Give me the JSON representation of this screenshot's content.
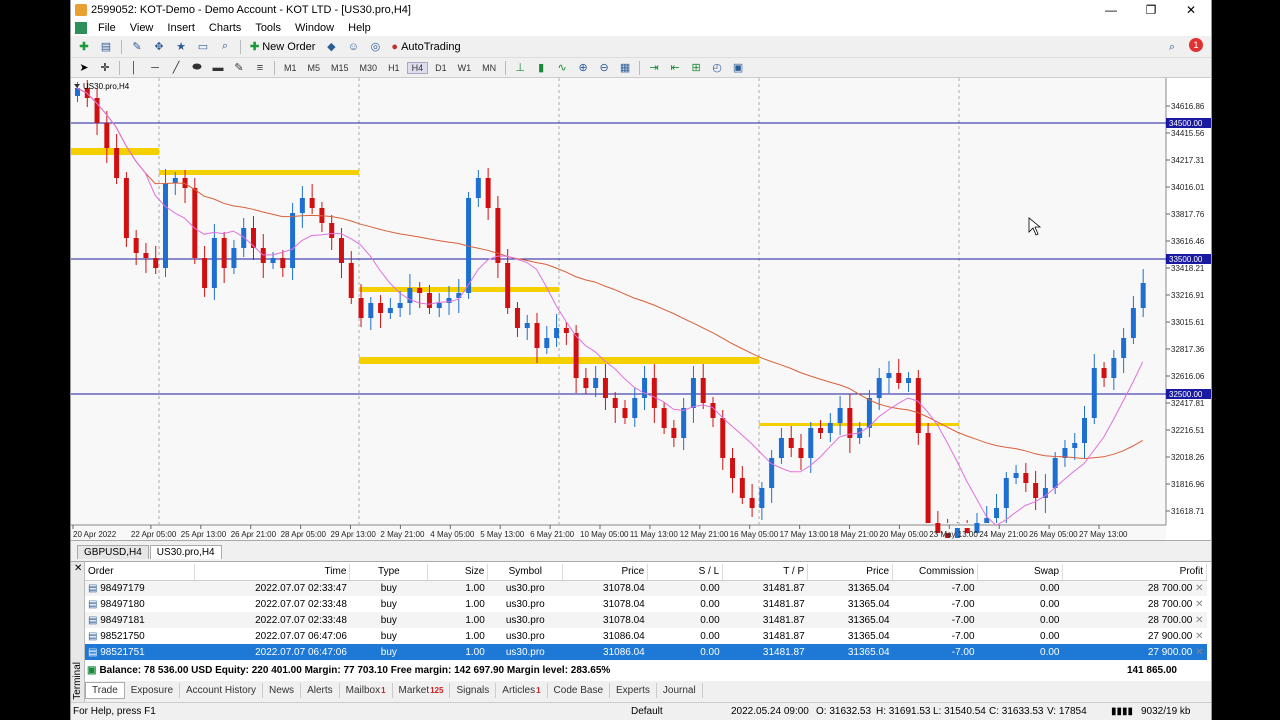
{
  "window": {
    "title": "2599052: KOT-Demo - Demo Account - KOT LTD - [US30.pro,H4]",
    "min": "—",
    "max": "❐",
    "close": "✕"
  },
  "menu": [
    "File",
    "View",
    "Insert",
    "Charts",
    "Tools",
    "Window",
    "Help"
  ],
  "toolbar": {
    "new_order": "New Order",
    "autotrading": "AutoTrading",
    "timeframes": [
      "M1",
      "M5",
      "M15",
      "M30",
      "H1",
      "H4",
      "D1",
      "W1",
      "MN"
    ],
    "active_timeframe": "H4"
  },
  "chart": {
    "symbol_label": "US30.pro,H4",
    "price_labels": [
      "34616.86",
      "34415.56",
      "34217.31",
      "34016.01",
      "33817.76",
      "33616.46",
      "33418.21",
      "33216.91",
      "33015.61",
      "32817.36",
      "32616.06",
      "32417.81",
      "32216.51",
      "32018.26",
      "31816.96",
      "31618.71"
    ],
    "level_labels": [
      "34500.00",
      "33500.00",
      "32500.00"
    ],
    "time_labels": [
      "20 Apr 2022",
      "22 Apr 05:00",
      "25 Apr 13:00",
      "26 Apr 21:00",
      "28 Apr 05:00",
      "29 Apr 13:00",
      "2 May 21:00",
      "4 May 05:00",
      "5 May 13:00",
      "6 May 21:00",
      "10 May 05:00",
      "11 May 13:00",
      "12 May 21:00",
      "16 May 05:00",
      "17 May 13:00",
      "18 May 21:00",
      "20 May 05:00",
      "23 May 13:00",
      "24 May 21:00",
      "26 May 05:00",
      "27 May 13:00"
    ],
    "colors": {
      "bull": "#1e6fd0",
      "bear": "#d01010",
      "level": "#1a1aa0",
      "zone": "#f5d000",
      "ma_slow": "#d9603a",
      "ma_fast": "#e070e0"
    }
  },
  "chart_tabs": [
    "GBPUSD,H4",
    "US30.pro,H4"
  ],
  "active_chart_tab": "US30.pro,H4",
  "terminal": {
    "label": "Terminal",
    "columns": [
      "Order",
      "Time",
      "Type",
      "Size",
      "Symbol",
      "Price",
      "S / L",
      "T / P",
      "Price",
      "Commission",
      "Swap",
      "Profit"
    ],
    "rows": [
      [
        "98497179",
        "2022.07.07 02:33:47",
        "buy",
        "1.00",
        "us30.pro",
        "31078.04",
        "0.00",
        "31481.87",
        "31365.04",
        "-7.00",
        "0.00",
        "28 700.00"
      ],
      [
        "98497180",
        "2022.07.07 02:33:48",
        "buy",
        "1.00",
        "us30.pro",
        "31078.04",
        "0.00",
        "31481.87",
        "31365.04",
        "-7.00",
        "0.00",
        "28 700.00"
      ],
      [
        "98497181",
        "2022.07.07 02:33:48",
        "buy",
        "1.00",
        "us30.pro",
        "31078.04",
        "0.00",
        "31481.87",
        "31365.04",
        "-7.00",
        "0.00",
        "28 700.00"
      ],
      [
        "98521750",
        "2022.07.07 06:47:06",
        "buy",
        "1.00",
        "us30.pro",
        "31086.04",
        "0.00",
        "31481.87",
        "31365.04",
        "-7.00",
        "0.00",
        "27 900.00"
      ],
      [
        "98521751",
        "2022.07.07 06:47:06",
        "buy",
        "1.00",
        "us30.pro",
        "31086.04",
        "0.00",
        "31481.87",
        "31365.04",
        "-7.00",
        "0.00",
        "27 900.00"
      ]
    ],
    "summary": "Balance: 78 536.00 USD  Equity: 220 401.00  Margin: 77 703.10  Free margin: 142 697.90  Margin level: 283.65%",
    "total_profit": "141 865.00",
    "tabs": [
      {
        "label": "Trade",
        "badge": ""
      },
      {
        "label": "Exposure",
        "badge": ""
      },
      {
        "label": "Account History",
        "badge": ""
      },
      {
        "label": "News",
        "badge": ""
      },
      {
        "label": "Alerts",
        "badge": ""
      },
      {
        "label": "Mailbox",
        "badge": "1"
      },
      {
        "label": "Market",
        "badge": "125"
      },
      {
        "label": "Signals",
        "badge": ""
      },
      {
        "label": "Articles",
        "badge": "1"
      },
      {
        "label": "Code Base",
        "badge": ""
      },
      {
        "label": "Experts",
        "badge": ""
      },
      {
        "label": "Journal",
        "badge": ""
      }
    ]
  },
  "status": {
    "help": "For Help, press F1",
    "profile": "Default",
    "datetime": "2022.05.24 09:00",
    "open": "O: 31632.53",
    "high": "H: 31691.53",
    "low": "L: 31540.54",
    "close": "C: 31633.53",
    "volume": "V: 17854",
    "traffic": "9032/19 kb"
  }
}
